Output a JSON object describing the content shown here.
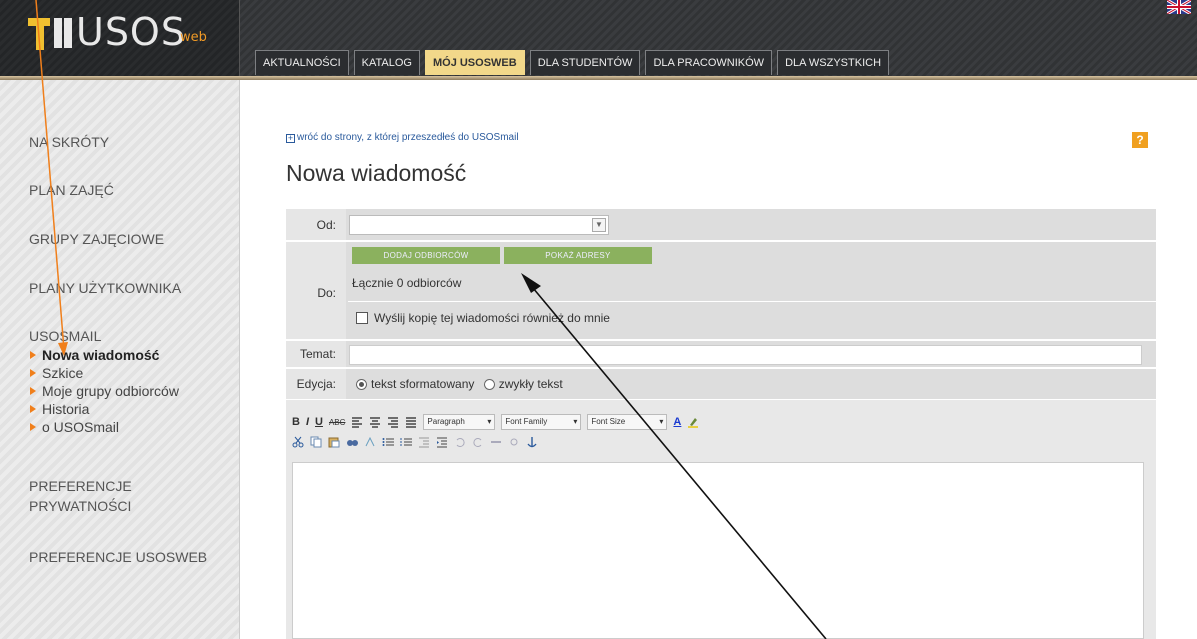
{
  "header": {
    "logo_text": "USOS",
    "logo_sub": "web",
    "tabs": [
      {
        "label": "AKTUALNOŚCI"
      },
      {
        "label": "KATALOG"
      },
      {
        "label": "MÓJ USOSWEB"
      },
      {
        "label": "DLA STUDENTÓW"
      },
      {
        "label": "DLA PRACOWNIKÓW"
      },
      {
        "label": "DLA WSZYSTKICH"
      }
    ],
    "language_icon": "uk-flag-icon"
  },
  "sidebar": {
    "links": [
      {
        "label": "NA SKRÓTY"
      },
      {
        "label": "PLAN ZAJĘĆ"
      },
      {
        "label": "GRUPY ZAJĘCIOWE"
      },
      {
        "label": "PLANY UŻYTKOWNIKA"
      },
      {
        "label": "USOSMAIL"
      }
    ],
    "usosmail_items": [
      {
        "label": "Nowa wiadomość"
      },
      {
        "label": "Szkice"
      },
      {
        "label": "Moje grupy odbiorców"
      },
      {
        "label": "Historia"
      },
      {
        "label": "o USOSmail"
      }
    ],
    "bottom_links": [
      {
        "label": "PREFERENCJE PRYWATNOŚCI"
      },
      {
        "label": "PREFERENCJE USOSWEB"
      }
    ]
  },
  "main": {
    "back_link": "wróć do strony, z której przeszedłeś do USOSmail",
    "title": "Nowa wiadomość",
    "from_label": "Od:",
    "from_value": "",
    "to_label": "Do:",
    "add_recipients_button": "DODAJ ODBIORCÓW",
    "show_addresses_button": "POKAŻ ADRESY",
    "recipient_count": "Łącznie 0 odbiorców",
    "copy_to_me_label": "Wyślij kopię tej wiadomości również do mnie",
    "subject_label": "Temat:",
    "subject_value": "",
    "edit_label": "Edycja:",
    "edit_option_formatted": "tekst sformatowany",
    "edit_option_plain": "zwykły tekst"
  },
  "editor": {
    "bold": "B",
    "italic": "I",
    "underline": "U",
    "strike": "ABC",
    "format_select": "Paragraph",
    "font_family_select": "Font Family",
    "font_size_select": "Font Size",
    "text_color": "A"
  },
  "colors": {
    "accent_orange": "#f07f1b",
    "tab_active": "#f2d88a",
    "button_green": "#8bb15e",
    "link_blue": "#2a5a9c"
  }
}
